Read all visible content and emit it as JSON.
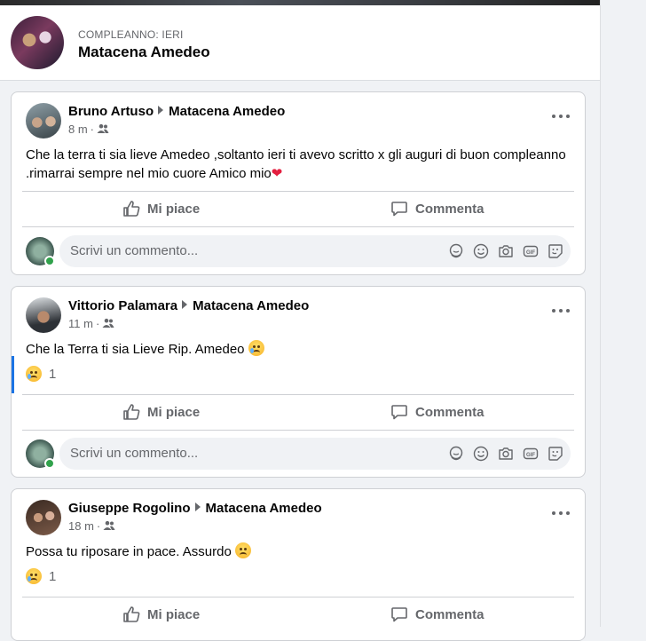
{
  "header": {
    "subtitle": "COMPLEANNO: IERI",
    "name": "Matacena Amedeo"
  },
  "posts": [
    {
      "author": "Bruno Artuso",
      "target": "Matacena Amedeo",
      "time": "8 m",
      "text": "Che la terra ti sia lieve Amedeo ,soltanto ieri ti avevo scritto x gli auguri di buon compleanno .rimarrai sempre nel mio cuore Amico mio",
      "like_label": "Mi piace",
      "comment_label": "Commenta",
      "comment_placeholder": "Scrivi un commento..."
    },
    {
      "author": "Vittorio Palamara",
      "target": "Matacena Amedeo",
      "time": "11 m",
      "text": "Che la Terra ti sia Lieve Rip. Amedeo",
      "reaction_count": "1",
      "like_label": "Mi piace",
      "comment_label": "Commenta",
      "comment_placeholder": "Scrivi un commento..."
    },
    {
      "author": "Giuseppe Rogolino",
      "target": "Matacena Amedeo",
      "time": "18 m",
      "text": "Possa tu riposare in pace. Assurdo",
      "reaction_count": "1",
      "like_label": "Mi piace",
      "comment_label": "Commenta"
    }
  ],
  "icons": {
    "more": "more-horizontal-icon",
    "friends": "friends-icon",
    "like": "thumbs-up-icon",
    "comment": "comment-bubble-icon",
    "comment_tools": [
      "avatar-sticker-icon",
      "emoji-icon",
      "camera-icon",
      "gif-icon",
      "sticker-icon"
    ]
  },
  "colors": {
    "accent": "#1b74e4",
    "background": "#f0f2f5",
    "text_secondary": "#65676b",
    "online": "#31a24c",
    "heart": "#e41e3f"
  }
}
